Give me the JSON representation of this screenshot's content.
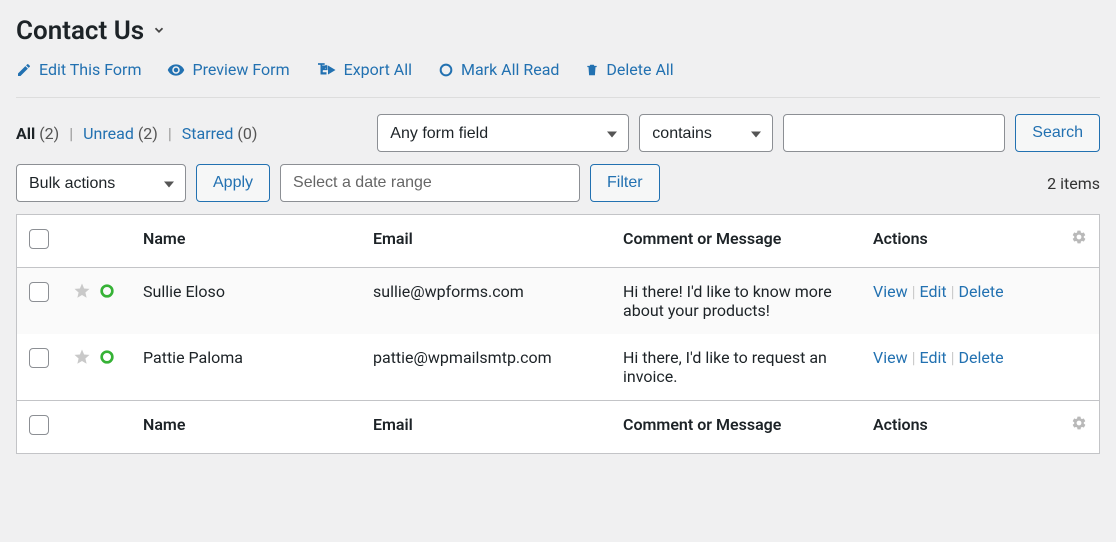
{
  "header": {
    "title": "Contact Us"
  },
  "toolbar": {
    "edit": "Edit This Form",
    "preview": "Preview Form",
    "export": "Export All",
    "mark_read": "Mark All Read",
    "delete": "Delete All"
  },
  "filters": {
    "all_label": "All",
    "all_count": "(2)",
    "unread_label": "Unread",
    "unread_count": "(2)",
    "starred_label": "Starred",
    "starred_count": "(0)"
  },
  "search": {
    "field_option": "Any form field",
    "condition_option": "contains",
    "value": "",
    "button": "Search"
  },
  "bulk": {
    "label": "Bulk actions",
    "apply": "Apply",
    "date_placeholder": "Select a date range",
    "filter": "Filter"
  },
  "pagination": {
    "items": "2 items"
  },
  "columns": {
    "name": "Name",
    "email": "Email",
    "message": "Comment or Message",
    "actions": "Actions"
  },
  "row_actions": {
    "view": "View",
    "edit": "Edit",
    "delete": "Delete"
  },
  "rows": [
    {
      "name": "Sullie Eloso",
      "email": "sullie@wpforms.com",
      "message": "Hi there! I'd like to know more about your products!"
    },
    {
      "name": "Pattie Paloma",
      "email": "pattie@wpmailsmtp.com",
      "message": "Hi there, I'd like to request an invoice."
    }
  ]
}
